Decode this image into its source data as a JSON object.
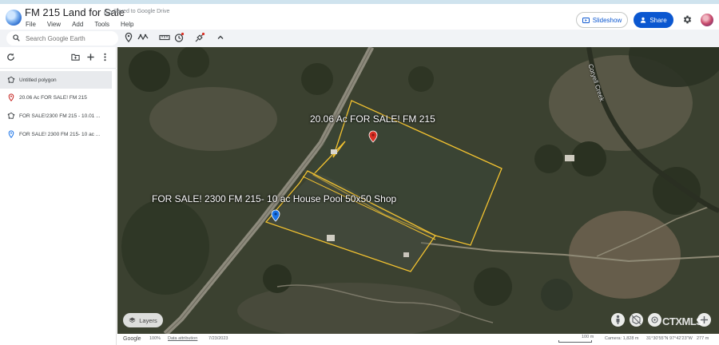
{
  "header": {
    "title": "FM 215 Land for Sale",
    "saved_status": "Saved to Google Drive",
    "menu": [
      "File",
      "View",
      "Add",
      "Tools",
      "Help"
    ],
    "slideshow_label": "Slideshow",
    "share_label": "Share"
  },
  "toolbar": {
    "search_placeholder": "Search Google Earth"
  },
  "sidebar": {
    "items": [
      {
        "label": "Untitled polygon",
        "icon": "polygon-icon",
        "selected": true
      },
      {
        "label": "20.06 Ac FOR SALE! FM 215",
        "icon": "placemark-icon",
        "color": "#c5221f"
      },
      {
        "label": "FOR SALE!2300 FM 215 - 10.01 ...",
        "icon": "polygon-icon"
      },
      {
        "label": "FOR SALE! 2300 FM 215- 10 ac ...",
        "icon": "placemark-icon",
        "color": "#1a73e8"
      }
    ]
  },
  "map": {
    "labels": {
      "parcel_a": "20.06 Ac FOR SALE! FM 215",
      "parcel_b": "FOR SALE! 2300 FM 215- 10 ac House Pool 50x50 Shop",
      "creek": "Coryell Creek"
    },
    "layers_label": "Layers",
    "watermark": "CTXMLS",
    "outline_color": "#f2c230"
  },
  "footer": {
    "google": "Google",
    "zoom": "100%",
    "attribution": "Data attribution",
    "date": "7/23/2023",
    "scale": "100 m",
    "camera": "Camera: 1,828 m",
    "coords": "31°30'55\"N 97°42'23\"W",
    "elevation": "277 m"
  },
  "colors": {
    "accent": "#0b57d0",
    "topstrip": "#cfe3ee"
  }
}
